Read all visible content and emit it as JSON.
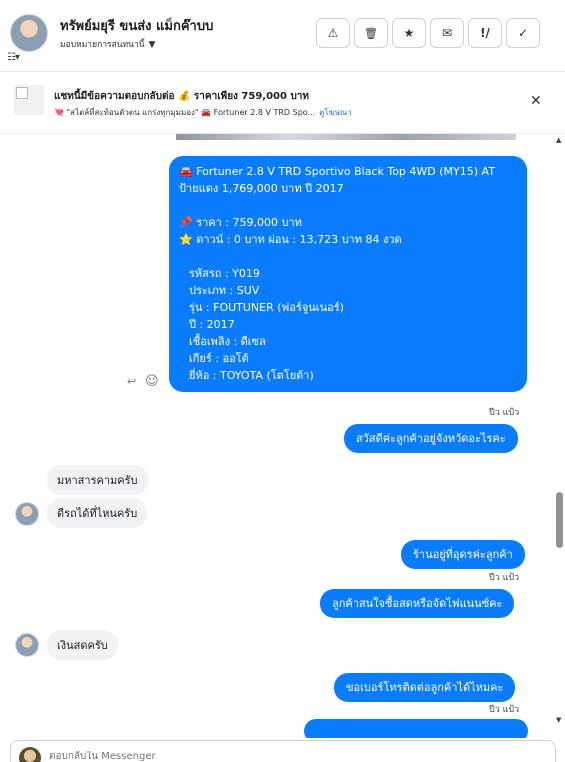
{
  "header": {
    "contact_name": "ทรัพย์มยุรี ขนส่ง แม็กค๊าบบ",
    "assign_label": "มอบหมายการสนทนานี้",
    "chevron": "▼",
    "settings_glyph": "☷▾",
    "buttons": [
      {
        "name": "report-button",
        "icon": "warning-icon",
        "glyph": "⚠"
      },
      {
        "name": "delete-button",
        "icon": "trash-icon",
        "glyph": "🗑"
      },
      {
        "name": "star-button",
        "icon": "star-icon",
        "glyph": "★"
      },
      {
        "name": "mark-unread-button",
        "icon": "envelope-icon",
        "glyph": "✉"
      },
      {
        "name": "spam-button",
        "icon": "exclamation-icon",
        "glyph": "!/"
      },
      {
        "name": "done-button",
        "icon": "check-icon",
        "glyph": "✓"
      }
    ]
  },
  "banner": {
    "title": "แชทนี้มีข้อความตอบกลับต่อ 💰 ราคาเพียง 759,000 บาท",
    "subtitle": "💘 \"สไตล์ที่สะท้อนตัวตน แกร่งทุกมุมมอง\" 🚘 Fortuner 2.8 V TRD Spo...",
    "link": "ดูโฆษณา",
    "close": "✕"
  },
  "messages": {
    "listing_lines": [
      "🚘 Fortuner 2.8 V TRD Sportivo Black Top 4WD (MY15) AT",
      "ป้ายแดง 1,769,000 บาท ปี 2017",
      "",
      "📌 ราคา : 759,000 บาท",
      "⭐ ดาวน์ : 0 บาท ผ่อน : 13,723 บาท 84 งวด",
      "",
      "รหัสรถ : Y019",
      "ประเภท : SUV",
      "รุ่น : FOUTUNER (ฟอร์จูนเนอร์)",
      "ปี : 2017",
      "เชื้อเพลิง : ดีเซล",
      "เกียร์ : ออโต้",
      "ยี่ห้อ : TOYOTA (โตโยต้า)"
    ],
    "reply_icon": "↩",
    "react_icon": "☺",
    "sender_name": "ปีว แป้ว",
    "out_1": "สวัสดีค่ะลูกค้าอยู่จังหวัดอะไรคะ",
    "in_1": "มหาสารคามครับ",
    "in_2": "ดีรถได้ที่ไหนครับ",
    "out_2": "ร้านอยู่ที่อุดรค่ะลูกค้า",
    "out_3": "ลูกค้าสนใจซื้อสดหรือจัดไฟแนนซ์คะ",
    "in_3": "เงินสดครับ",
    "out_4": "ขอเบอร์โทรติดต่อลูกค้าได้ไหมคะ"
  },
  "composer": {
    "placeholder": "ตอบกลับใน Messenger"
  },
  "scrollbar": {
    "up": "▲",
    "down": "▼"
  }
}
